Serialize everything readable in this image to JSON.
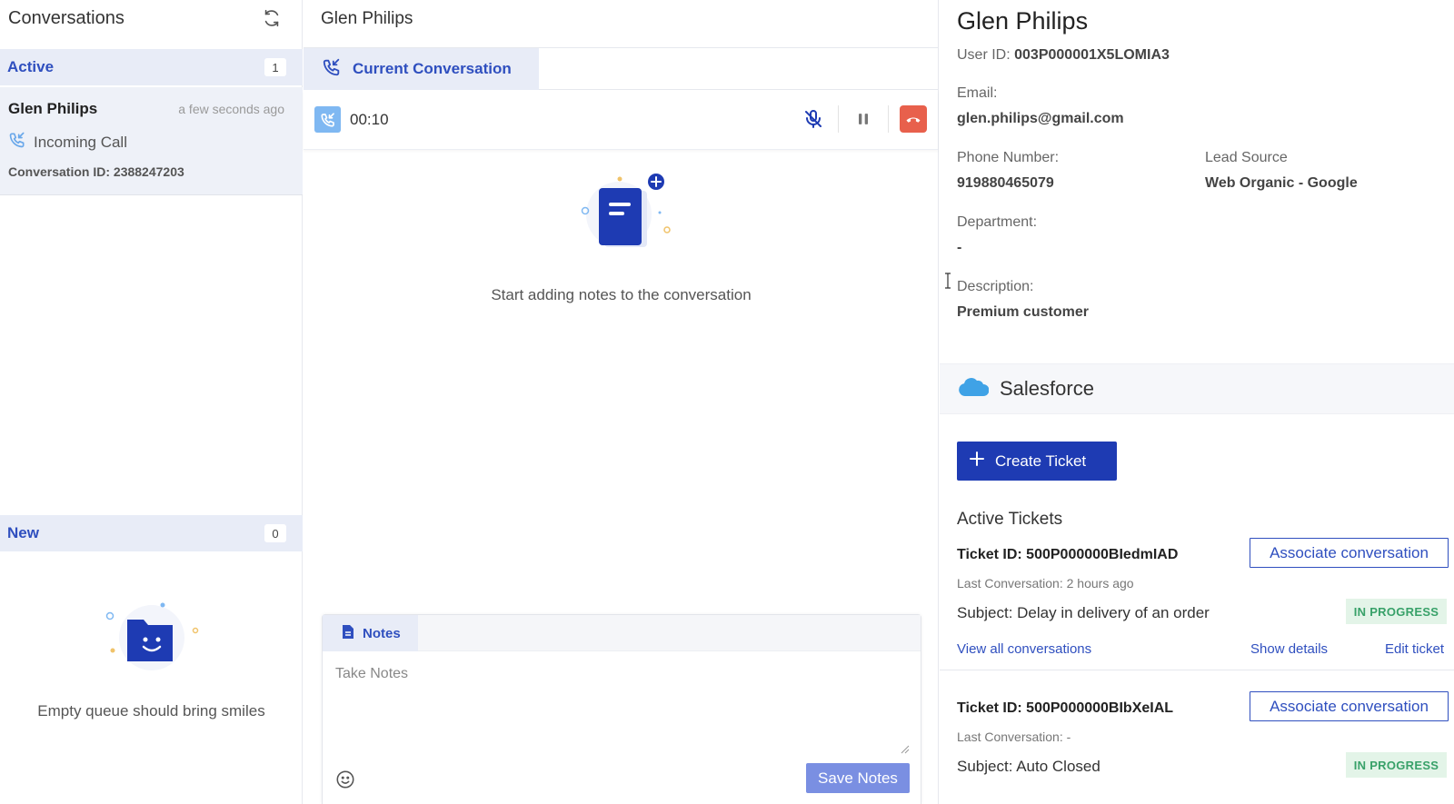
{
  "left": {
    "title": "Conversations",
    "active": {
      "label": "Active",
      "count": "1"
    },
    "conversation": {
      "name": "Glen Philips",
      "time": "a few seconds ago",
      "type": "Incoming Call",
      "conversation_id": "Conversation ID: 2388247203"
    },
    "new": {
      "label": "New",
      "count": "0"
    },
    "empty_message": "Empty queue should bring smiles"
  },
  "middle": {
    "header_title": "Glen Philips",
    "tab_label": "Current Conversation",
    "call_timer": "00:10",
    "notes_empty_message": "Start adding notes to the conversation",
    "notes": {
      "tab_label": "Notes",
      "placeholder": "Take Notes",
      "value": "",
      "save_label": "Save Notes"
    }
  },
  "right": {
    "name": "Glen Philips",
    "user_id_label": "User ID: ",
    "user_id": "003P000001X5LOMIA3",
    "email_label": "Email:",
    "email": "glen.philips@gmail.com",
    "phone_label": "Phone Number:",
    "phone": "919880465079",
    "lead_source_label": "Lead Source",
    "lead_source": "Web Organic - Google",
    "department_label": "Department:",
    "department": "-",
    "description_label": "Description:",
    "description": "Premium customer",
    "salesforce_label": "Salesforce",
    "create_ticket_label": "Create Ticket",
    "active_tickets_label": "Active Tickets",
    "tickets": [
      {
        "id": "Ticket ID: 500P000000BIedmIAD",
        "associate_label": "Associate conversation",
        "last_conversation": "Last Conversation: 2 hours ago",
        "subject": "Subject: Delay in delivery of an order",
        "status": "IN PROGRESS",
        "view_all_label": "View all conversations",
        "show_details_label": "Show details",
        "edit_label": "Edit ticket"
      },
      {
        "id": "Ticket ID: 500P000000BIbXeIAL",
        "associate_label": "Associate conversation",
        "last_conversation": "Last Conversation: -",
        "subject": "Subject: Auto Closed",
        "status": "IN PROGRESS"
      }
    ]
  },
  "colors": {
    "accent": "#2f4fbf",
    "primary_button": "#1e3bb3",
    "section_bg": "#e8ecf7",
    "hangup": "#e8604c",
    "status_green": "#38a169"
  }
}
